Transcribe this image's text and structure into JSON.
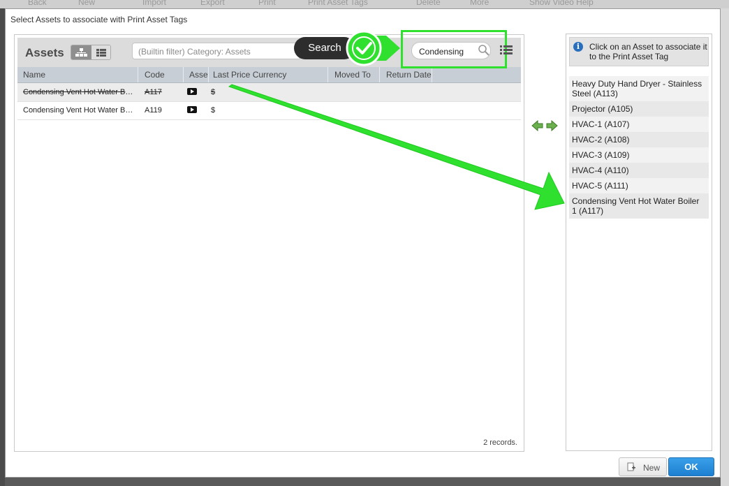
{
  "background_toolbar": {
    "items": [
      "Back",
      "New",
      "Import",
      "Export",
      "Print",
      "Print Asset Tags",
      "Delete",
      "More",
      "Show Video Help"
    ]
  },
  "modal": {
    "title": "Select Assets to associate with Print Asset Tags"
  },
  "left_panel": {
    "title": "Assets",
    "filter_placeholder": "(Builtin filter) Category: Assets",
    "columns": [
      "Name",
      "Code",
      "Asset",
      "Last Price Currency",
      "Moved To",
      "Return Date"
    ],
    "rows": [
      {
        "name": "Condensing Vent Hot Water Boil...",
        "code": "A117",
        "currency": "$",
        "struck": true
      },
      {
        "name": "Condensing Vent Hot Water Boil...",
        "code": "A119",
        "currency": "$",
        "struck": false
      }
    ],
    "records_text": "2 records."
  },
  "callout": {
    "search_label": "Search",
    "search_value": "Condensing",
    "accent_color": "#2fe02f"
  },
  "right_panel": {
    "info_text": "Click on an Asset to associate it to the Print Asset Tag",
    "items": [
      "Heavy Duty Hand Dryer - Stainless Steel (A113)",
      "Projector (A105)",
      "HVAC-1 (A107)",
      "HVAC-2 (A108)",
      "HVAC-3 (A109)",
      "HVAC-4 (A110)",
      "HVAC-5 (A111)",
      "Condensing Vent Hot Water Boiler 1 (A117)"
    ]
  },
  "footer": {
    "new_label": "New",
    "ok_label": "OK"
  }
}
